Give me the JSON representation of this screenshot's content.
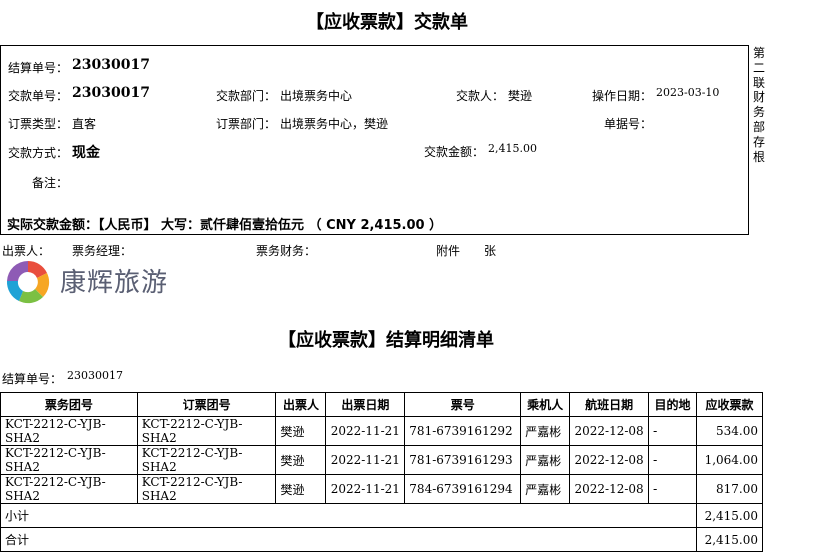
{
  "voucher": {
    "title": "【应收票款】交款单",
    "settle_no_label": "结算单号：",
    "settle_no": "23030017",
    "pay_no_label": "交款单号：",
    "pay_no": "23030017",
    "pay_dept_label": "交款部门：",
    "pay_dept": "出境票务中心",
    "payer_label": "交款人：",
    "payer": "樊逊",
    "op_date_label": "操作日期：",
    "op_date": "2023-03-10",
    "order_type_label": "订票类型：",
    "order_type": "直客",
    "order_dept_label": "订票部门：",
    "order_dept": "出境票务中心，樊逊",
    "doc_no_label": "单据号：",
    "pay_method_label": "交款方式：",
    "pay_method": "现金",
    "amount_label": "交款金额：",
    "amount": "2,415.00",
    "remark_label": "备注：",
    "actual_label": "实际交款金额：【人民币】 大写：贰仟肆佰壹拾伍元 （ CNY 2,415.00 ）",
    "side_note": "第二联财务部存根"
  },
  "signatures": {
    "issuer_label": "出票人：",
    "manager_label": "票务经理：",
    "finance_label": "票务财务：",
    "attach_label": "附件",
    "sheet_label": "张"
  },
  "brand": {
    "name": "康辉旅游",
    "colors": [
      "#e94e3d",
      "#f6a623",
      "#7bc043",
      "#1fa2d6",
      "#8e5bb5"
    ]
  },
  "detail": {
    "title": "【应收票款】结算明细清单",
    "settle_no_label": "结算单号：",
    "settle_no": "23030017",
    "headers": [
      "票务团号",
      "订票团号",
      "出票人",
      "出票日期",
      "票号",
      "乘机人",
      "航班日期",
      "目的地",
      "应收票款"
    ],
    "rows": [
      [
        "KCT-2212-C-YJB-SHA2",
        "KCT-2212-C-YJB-SHA2",
        "樊逊",
        "2022-11-21",
        "781-6739161292",
        "严嘉彬",
        "2022-12-08",
        "-",
        "534.00"
      ],
      [
        "KCT-2212-C-YJB-SHA2",
        "KCT-2212-C-YJB-SHA2",
        "樊逊",
        "2022-11-21",
        "781-6739161293",
        "严嘉彬",
        "2022-12-08",
        "-",
        "1,064.00"
      ],
      [
        "KCT-2212-C-YJB-SHA2",
        "KCT-2212-C-YJB-SHA2",
        "樊逊",
        "2022-11-21",
        "784-6739161294",
        "严嘉彬",
        "2022-12-08",
        "-",
        "817.00"
      ]
    ],
    "subtotal_label": "小计",
    "subtotal": "2,415.00",
    "total_label": "合计",
    "total": "2,415.00"
  }
}
